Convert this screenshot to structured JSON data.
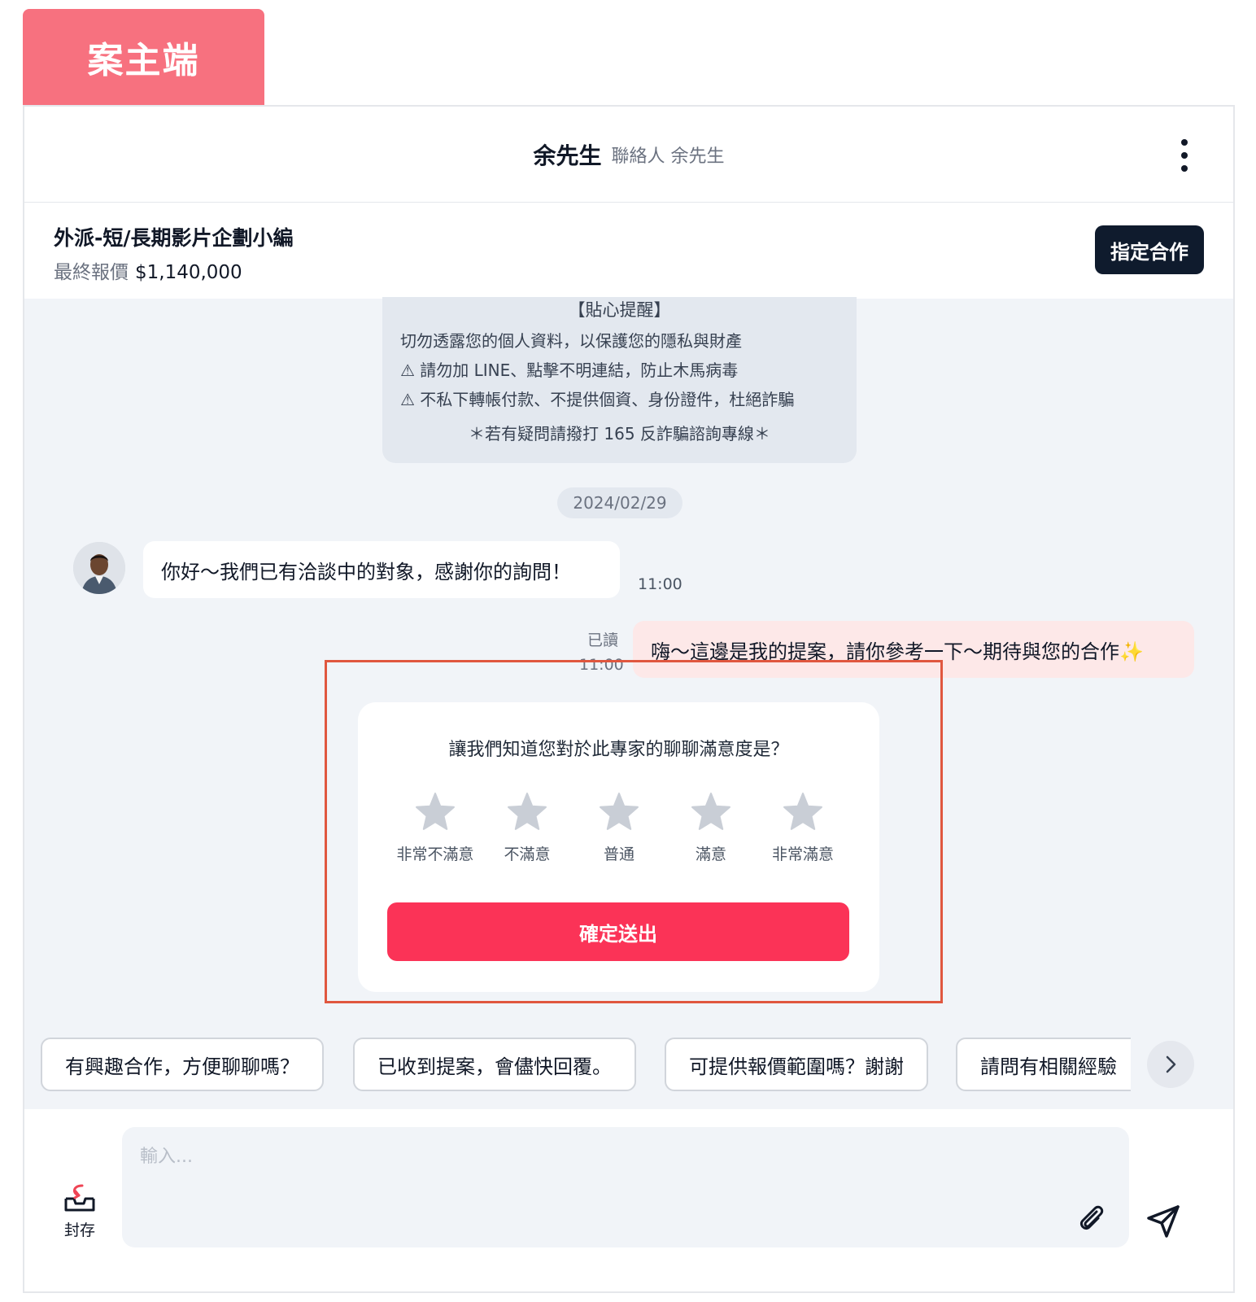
{
  "tab_badge": "案主端",
  "header": {
    "name": "余先生",
    "subtitle": "聯絡人 余先生",
    "menu_icon": "kebab-menu-icon"
  },
  "project": {
    "title": "外派-短/長期影片企劃小編",
    "price_label": "最終報價",
    "price_value": "$1,140,000",
    "assign_button": "指定合作"
  },
  "tips": {
    "heading": "【貼心提醒】",
    "line1": "切勿透露您的個人資料，以保護您的隱私與財產",
    "line2": "⚠ 請勿加 LINE、點擊不明連結，防止木馬病毒",
    "line3": "⚠ 不私下轉帳付款、不提供個資、身份證件，杜絕詐騙",
    "footer": "＊若有疑問請撥打 165 反詐騙諮詢專線＊"
  },
  "date_divider": "2024/02/29",
  "messages": {
    "incoming": {
      "text": "你好～我們已有洽談中的對象，感謝你的詢問！",
      "time": "11:00"
    },
    "outgoing": {
      "text": "嗨～這邊是我的提案，請你參考一下～期待與您的合作✨",
      "read_label": "已讀",
      "time": "11:00"
    }
  },
  "rating": {
    "question": "讓我們知道您對於此專家的聊聊滿意度是？",
    "options": [
      "非常不滿意",
      "不滿意",
      "普通",
      "滿意",
      "非常滿意"
    ],
    "submit": "確定送出",
    "star_color": "#c9ced6"
  },
  "quick_replies": [
    "有興趣合作，方便聊聊嗎？",
    "已收到提案，會儘快回覆。",
    "可提供報價範圍嗎？謝謝",
    "請問有相關經驗"
  ],
  "composer": {
    "archive_label": "封存",
    "placeholder": "輸入...",
    "attach_icon": "paperclip-icon",
    "send_icon": "send-icon"
  },
  "colors": {
    "badge": "#f7717f",
    "submit": "#fb3357",
    "assign": "#0f1b2d",
    "highlight": "#e0573f"
  }
}
